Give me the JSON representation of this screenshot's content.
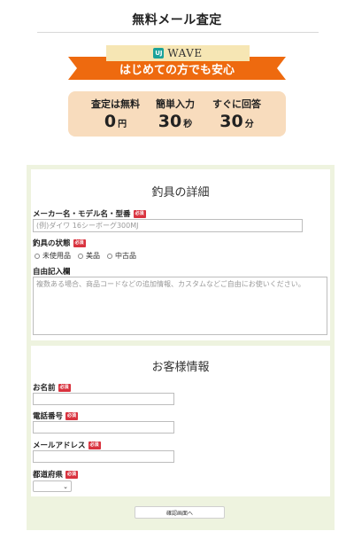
{
  "page": {
    "title": "無料メール査定"
  },
  "banner": {
    "logo_mark": "UJ",
    "logo_text": "WAVE",
    "tagline": "はじめての方でも安心",
    "ribbon_color": "#ee6a0f"
  },
  "stats": [
    {
      "label": "査定は無料",
      "value": "0",
      "unit": "円"
    },
    {
      "label": "簡単入力",
      "value": "30",
      "unit": "秒"
    },
    {
      "label": "すぐに回答",
      "value": "30",
      "unit": "分"
    }
  ],
  "required_badge": "必須",
  "tackle_section": {
    "title": "釣具の詳細",
    "maker_label": "メーカー名・モデル名・型番",
    "maker_placeholder": "(例)ダイワ 16シーボーグ300MJ",
    "condition_label": "釣具の状態",
    "condition_options": [
      "未使用品",
      "美品",
      "中古品"
    ],
    "notes_label": "自由記入欄",
    "notes_placeholder": "複数ある場合、商品コードなどの追加情報、カスタムなどご自由にお使いください。"
  },
  "customer_section": {
    "title": "お客様情報",
    "name_label": "お名前",
    "phone_label": "電話番号",
    "email_label": "メールアドレス",
    "prefecture_label": "都道府県",
    "prefecture_value": ""
  },
  "confirm_button": "確認画面へ",
  "colors": {
    "accent": "#ee6a0f",
    "stats_bg": "#f8dcbd",
    "form_bg": "#eef3df",
    "required": "#d9333f"
  }
}
